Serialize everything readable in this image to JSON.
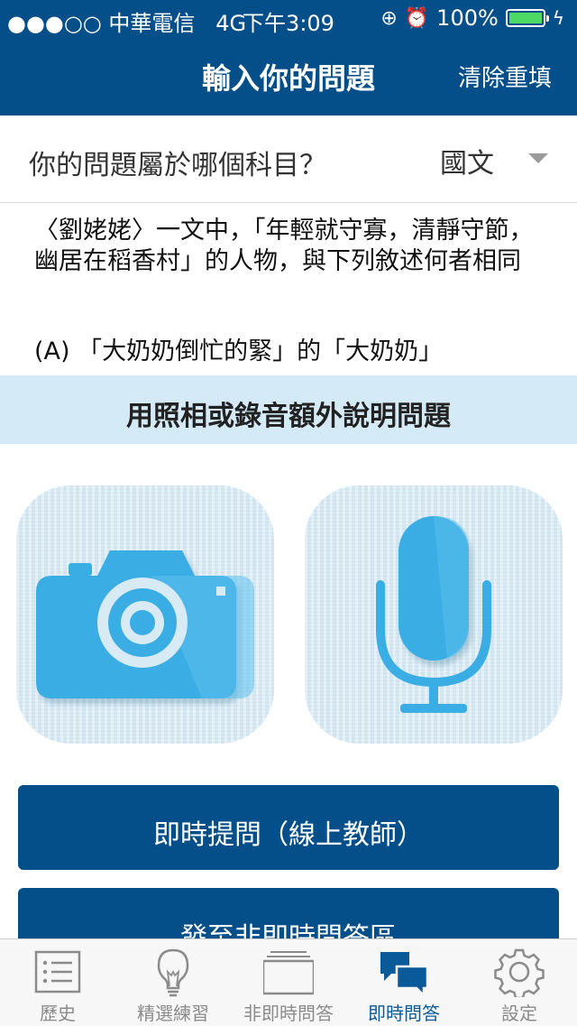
{
  "status_bar": {
    "signal_carrier": "●●●○○ 中華電信",
    "network": "4G",
    "time": "下午3:09",
    "battery": "100%"
  },
  "nav": {
    "title": "輸入你的問題",
    "clear_label": "清除重填"
  },
  "subject": {
    "question": "你的問題屬於哪個科目？",
    "value": "國文"
  },
  "question_text": {
    "body": "〈劉姥姥〉一文中，「年輕就守寡，清靜守節，幽居在稻香村」的人物，與下列敘述何者相同",
    "option_a": "(A) 「大奶奶倒忙的緊」的「大奶奶」"
  },
  "extra": {
    "label": "用照相或錄音額外說明問題"
  },
  "buttons": {
    "live_ask": "即時提問（線上教師）",
    "send_non_live": "發至非即時問答區"
  },
  "tabs": [
    {
      "label": "歷史",
      "icon": "list-icon",
      "active": false
    },
    {
      "label": "精選練習",
      "icon": "lightbulb-icon",
      "active": false
    },
    {
      "label": "非即時問答",
      "icon": "stack-icon",
      "active": false
    },
    {
      "label": "即時問答",
      "icon": "chat-bubbles-icon",
      "active": true
    },
    {
      "label": "設定",
      "icon": "gear-icon",
      "active": false
    }
  ],
  "colors": {
    "primary": "#044f8a",
    "accent_light": "#d4ebf7",
    "icon_blue": "#3aaee4",
    "battery_green": "#4cd964"
  }
}
